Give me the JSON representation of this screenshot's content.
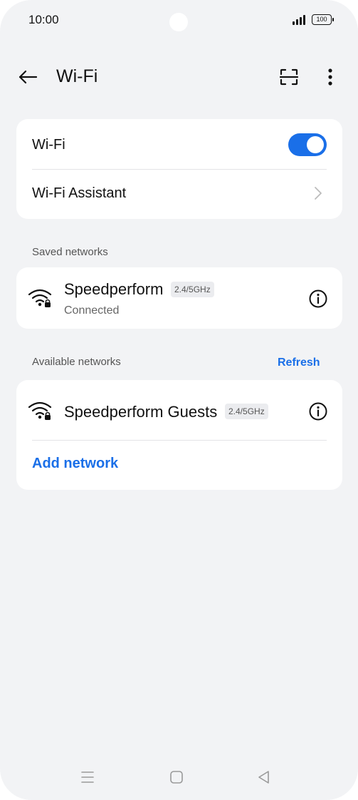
{
  "status_bar": {
    "time": "10:00",
    "battery": "100"
  },
  "header": {
    "title": "Wi-Fi"
  },
  "wifi_card": {
    "wifi_label": "Wi-Fi",
    "wifi_enabled": true,
    "assistant_label": "Wi-Fi Assistant"
  },
  "saved_networks": {
    "section_label": "Saved networks",
    "items": [
      {
        "name": "Speedperform",
        "band": "2.4/5GHz",
        "status": "Connected"
      }
    ]
  },
  "available_networks": {
    "section_label": "Available networks",
    "refresh_label": "Refresh",
    "items": [
      {
        "name": "Speedperform Guests",
        "band": "2.4/5GHz"
      }
    ],
    "add_network_label": "Add network"
  },
  "colors": {
    "accent": "#1a6fe8",
    "background": "#f2f3f5",
    "card": "#ffffff"
  },
  "icons": [
    "back-arrow-icon",
    "scan-icon",
    "more-vert-icon",
    "chevron-right-icon",
    "wifi-lock-icon",
    "info-icon",
    "menu-icon",
    "home-icon",
    "back-triangle-icon"
  ]
}
